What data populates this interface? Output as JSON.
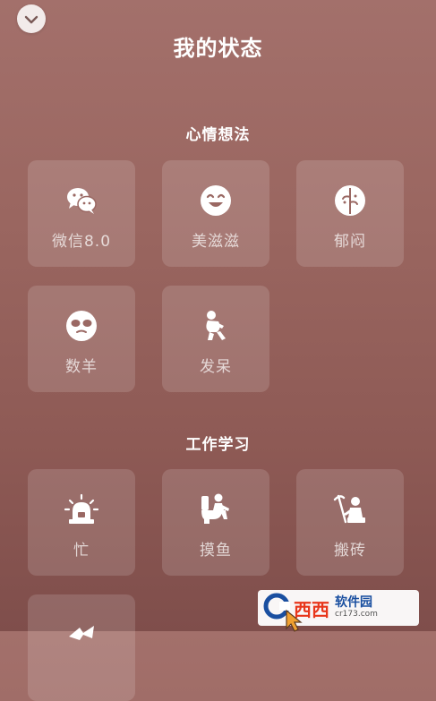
{
  "header": {
    "title": "我的状态",
    "collapse_icon": "chevron-down-icon"
  },
  "sections": [
    {
      "title": "心情想法",
      "items": [
        {
          "label": "微信8.0",
          "icon": "wechat-icon"
        },
        {
          "label": "美滋滋",
          "icon": "smile-face-icon"
        },
        {
          "label": "郁闷",
          "icon": "wilted-leaf-icon"
        },
        {
          "label": "数羊",
          "icon": "sleepy-face-icon"
        },
        {
          "label": "发呆",
          "icon": "squatting-person-icon"
        }
      ]
    },
    {
      "title": "工作学习",
      "items": [
        {
          "label": "忙",
          "icon": "alarm-siren-icon"
        },
        {
          "label": "摸鱼",
          "icon": "person-at-toilet-icon"
        },
        {
          "label": "搬砖",
          "icon": "person-with-pickaxe-icon"
        },
        {
          "label": "",
          "icon": "partial-icon"
        }
      ]
    }
  ],
  "watermark": {
    "brand": "西西",
    "name": "软件园",
    "url": "cr173.com"
  },
  "colors": {
    "bg_top": "#a3706b",
    "bg_bottom": "#7f4e4b",
    "tile_bg": "rgba(255,255,255,0.14)",
    "watermark_red": "#e8361b",
    "watermark_blue": "#1a4fa0"
  }
}
